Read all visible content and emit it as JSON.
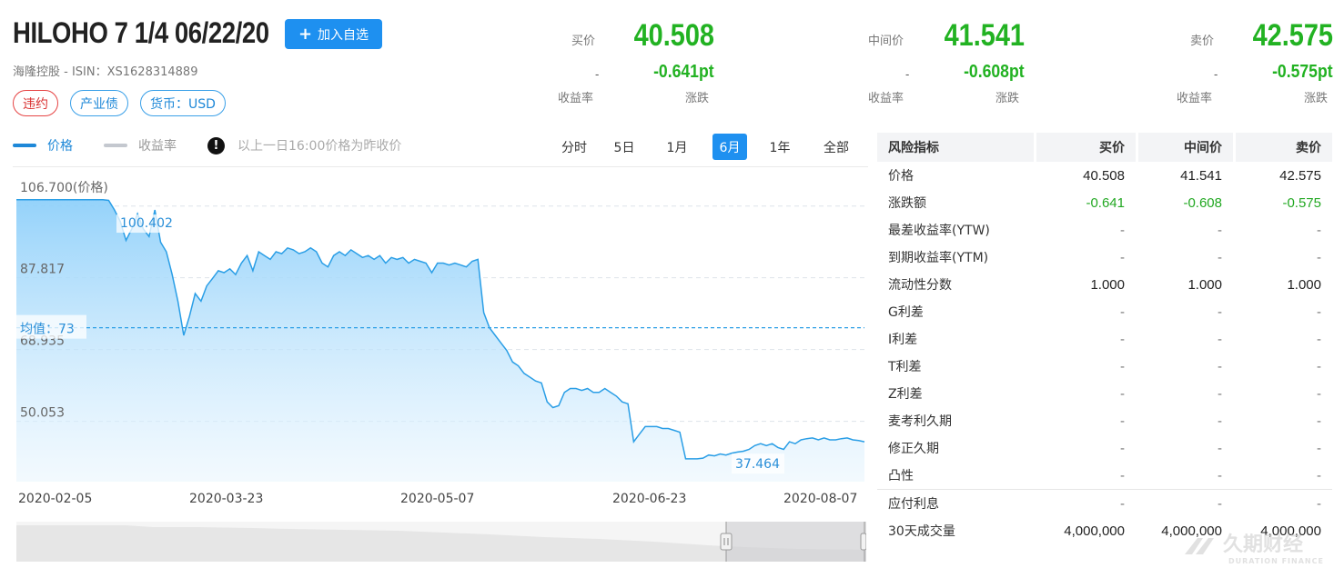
{
  "header": {
    "title": "HILOHO 7 1/4 06/22/20",
    "watch_label": "加入自选",
    "issuer_line": "海隆控股 - ISIN：XS1628314889",
    "tags": [
      "违约",
      "产业债",
      "货币：USD"
    ]
  },
  "quotes": [
    {
      "label": "买价",
      "price": "40.508",
      "yield": "-",
      "change": "-0.641pt",
      "yield_label": "收益率",
      "change_label": "涨跌"
    },
    {
      "label": "中间价",
      "price": "41.541",
      "yield": "-",
      "change": "-0.608pt",
      "yield_label": "收益率",
      "change_label": "涨跌"
    },
    {
      "label": "卖价",
      "price": "42.575",
      "yield": "-",
      "change": "-0.575pt",
      "yield_label": "收益率",
      "change_label": "涨跌"
    }
  ],
  "legend": {
    "price": "价格",
    "yield": "收益率",
    "note": "以上一日16:00价格为昨收价",
    "info_glyph": "!"
  },
  "periods": [
    "分时",
    "5日",
    "1月",
    "6月",
    "1年",
    "全部"
  ],
  "active_period": "6月",
  "chart_data": {
    "type": "area",
    "y_ticks": [
      "106.700(价格)",
      "87.817",
      "68.935",
      "50.053"
    ],
    "y_tick_values": [
      106.7,
      87.817,
      68.935,
      50.053
    ],
    "x_ticks": [
      "2020-02-05",
      "2020-03-23",
      "2020-05-07",
      "2020-06-23",
      "2020-08-07"
    ],
    "ylim": [
      32.5,
      109.5
    ],
    "mean_label": "均值：73",
    "mean_value": 73,
    "max_label": "100.402",
    "max_value": 100.402,
    "min_label": "37.464",
    "min_value": 37.464,
    "series": [
      {
        "name": "价格",
        "values": [
          106.7,
          106.7,
          106.7,
          106.7,
          106.7,
          106.7,
          106.7,
          106.7,
          106.7,
          106.7,
          106.7,
          106.7,
          106.7,
          106.7,
          106.7,
          106.7,
          106.5,
          104,
          101,
          96,
          99,
          103,
          99,
          97,
          104,
          95.5,
          93,
          87,
          80,
          71,
          76,
          82,
          80,
          84,
          86,
          88,
          87.5,
          88.5,
          87,
          90,
          92,
          88,
          93,
          92,
          91,
          93,
          92.5,
          94,
          93.5,
          92.5,
          93,
          94,
          93,
          90,
          89,
          92,
          93,
          92,
          93.5,
          92.5,
          91.5,
          92,
          91,
          92,
          90,
          91.5,
          91,
          91.5,
          90,
          91,
          90.5,
          90,
          87.5,
          90,
          90,
          89.5,
          90,
          89.5,
          89,
          90.5,
          91,
          77,
          73,
          71,
          69,
          67,
          64,
          63,
          61,
          60,
          59,
          58.5,
          53.5,
          52,
          52.5,
          56,
          57,
          57,
          56.5,
          57,
          56,
          56,
          57,
          56,
          55,
          53.5,
          53,
          43,
          45,
          47,
          47,
          47,
          46.5,
          46.5,
          46,
          45.5,
          38.5,
          38.5,
          38.5,
          38.7,
          39.5,
          39.3,
          39.8,
          39.5,
          40,
          40.3,
          40.5,
          41,
          42,
          42.5,
          42,
          42.5,
          41.5,
          41,
          43,
          42.5,
          43.5,
          43.8,
          44,
          43.5,
          44,
          43.5,
          43.5,
          43.8,
          44,
          43.5,
          43.3,
          43
        ]
      }
    ],
    "legend_position": "top-left",
    "grid": "horizontal dashed"
  },
  "risk_table": {
    "headers": [
      "风险指标",
      "买价",
      "中间价",
      "卖价"
    ],
    "rows": [
      {
        "name": "价格",
        "values": [
          "40.508",
          "41.541",
          "42.575"
        ],
        "neg": false
      },
      {
        "name": "涨跌额",
        "values": [
          "-0.641",
          "-0.608",
          "-0.575"
        ],
        "neg": true
      },
      {
        "name": "最差收益率(YTW)",
        "values": [
          "-",
          "-",
          "-"
        ],
        "neg": false
      },
      {
        "name": "到期收益率(YTM)",
        "values": [
          "-",
          "-",
          "-"
        ],
        "neg": false
      },
      {
        "name": "流动性分数",
        "values": [
          "1.000",
          "1.000",
          "1.000"
        ],
        "neg": false
      },
      {
        "name": "G利差",
        "values": [
          "-",
          "-",
          "-"
        ],
        "neg": false
      },
      {
        "name": "I利差",
        "values": [
          "-",
          "-",
          "-"
        ],
        "neg": false
      },
      {
        "name": "T利差",
        "values": [
          "-",
          "-",
          "-"
        ],
        "neg": false
      },
      {
        "name": "Z利差",
        "values": [
          "-",
          "-",
          "-"
        ],
        "neg": false
      },
      {
        "name": "麦考利久期",
        "values": [
          "-",
          "-",
          "-"
        ],
        "neg": false
      },
      {
        "name": "修正久期",
        "values": [
          "-",
          "-",
          "-"
        ],
        "neg": false
      },
      {
        "name": "凸性",
        "values": [
          "-",
          "-",
          "-"
        ],
        "neg": false
      }
    ],
    "lower_rows": [
      {
        "name": "应付利息",
        "values": [
          "-",
          "-",
          "-"
        ]
      },
      {
        "name": "30天成交量",
        "values": [
          "4,000,000",
          "4,000,000",
          "4,000,000"
        ]
      }
    ]
  },
  "watermark": {
    "cn": "久期财经",
    "en": "DURATION FINANCE"
  },
  "colors": {
    "accent": "#1e90f0",
    "price_line": "#2a9ee6",
    "negative": "#22b222",
    "default_tag": "#e64545"
  }
}
